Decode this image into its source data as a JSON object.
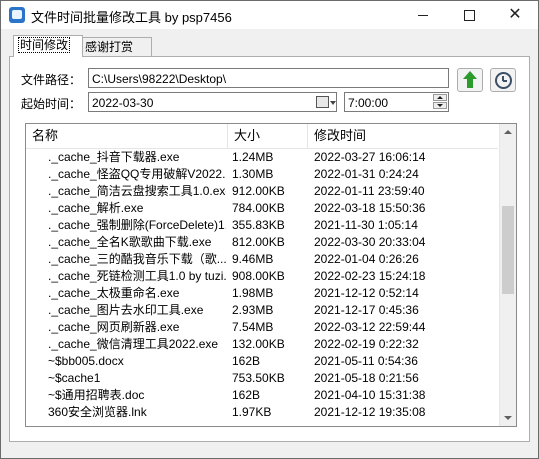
{
  "window": {
    "title": "文件时间批量修改工具 by psp7456"
  },
  "tabs": [
    {
      "label": "时间修改",
      "active": true
    },
    {
      "label": "感谢打赏",
      "active": false
    }
  ],
  "form": {
    "path_label": "文件路径：",
    "path_value": "C:\\Users\\98222\\Desktop\\",
    "start_label": "起始时间：",
    "date_value": "2022-03-30",
    "time_value": "7:00:00"
  },
  "buttons": {
    "apply_icon": "arrow-up-icon",
    "history_icon": "history-icon"
  },
  "list": {
    "columns": [
      "名称",
      "大小",
      "修改时间"
    ],
    "rows": [
      {
        "name": "._cache_抖音下载器.exe",
        "size": "1.24MB",
        "time": "2022-03-27 16:06:14"
      },
      {
        "name": "._cache_怪盗QQ专用破解V2022...",
        "size": "1.30MB",
        "time": "2022-01-31 0:24:24"
      },
      {
        "name": "._cache_简洁云盘搜索工具1.0.exe",
        "size": "912.00KB",
        "time": "2022-01-11 23:59:40"
      },
      {
        "name": "._cache_解析.exe",
        "size": "784.00KB",
        "time": "2022-03-18 15:50:36"
      },
      {
        "name": "._cache_强制删除(ForceDelete)1....",
        "size": "355.83KB",
        "time": "2021-11-30 1:05:14"
      },
      {
        "name": "._cache_全名K歌歌曲下载.exe",
        "size": "812.00KB",
        "time": "2022-03-30 20:33:04"
      },
      {
        "name": "._cache_三的酷我音乐下载（歌...",
        "size": "9.46MB",
        "time": "2022-01-04 0:26:26"
      },
      {
        "name": "._cache_死链检测工具1.0 by tuzi...",
        "size": "908.00KB",
        "time": "2022-02-23 15:24:18"
      },
      {
        "name": "._cache_太极重命名.exe",
        "size": "1.98MB",
        "time": "2021-12-12 0:52:14"
      },
      {
        "name": "._cache_图片去水印工具.exe",
        "size": "2.93MB",
        "time": "2021-12-17 0:45:36"
      },
      {
        "name": "._cache_网页刷新器.exe",
        "size": "7.54MB",
        "time": "2022-03-12 22:59:44"
      },
      {
        "name": "._cache_微信清理工具2022.exe",
        "size": "132.00KB",
        "time": "2022-02-19 0:22:32"
      },
      {
        "name": "~$bb005.docx",
        "size": "162B",
        "time": "2021-05-11 0:54:36"
      },
      {
        "name": "~$cache1",
        "size": "753.50KB",
        "time": "2021-05-18 0:21:56"
      },
      {
        "name": "~$通用招聘表.doc",
        "size": "162B",
        "time": "2021-04-10 15:31:38"
      },
      {
        "name": "360安全浏览器.lnk",
        "size": "1.97KB",
        "time": "2021-12-12 19:35:08"
      }
    ],
    "scroll_fraction": 0.36
  }
}
